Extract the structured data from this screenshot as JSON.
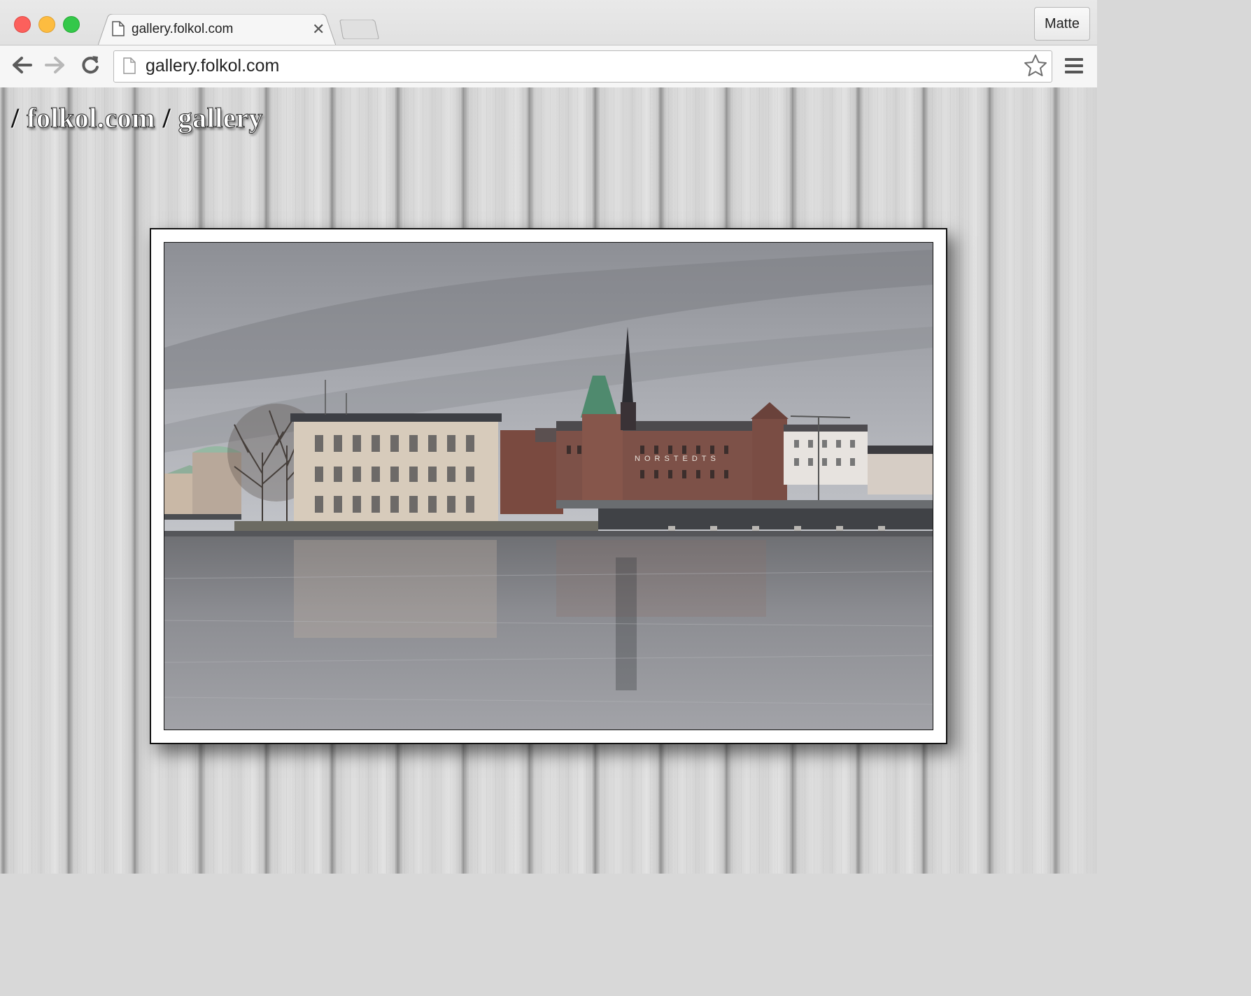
{
  "window": {
    "tab_title": "gallery.folkol.com",
    "profile_label": "Matte",
    "address": "gallery.folkol.com"
  },
  "icons": {
    "tab_page": "page-icon",
    "tab_close": "close-icon",
    "back": "arrow-left-icon",
    "forward": "arrow-right-icon",
    "reload": "reload-icon",
    "address_page": "page-icon",
    "bookmark": "star-icon",
    "menu": "hamburger-menu-icon"
  },
  "page": {
    "breadcrumb": {
      "separator": "/",
      "site": "folkol.com",
      "section": "gallery"
    },
    "photo": {
      "signage_text": "NORSTEDTS"
    }
  },
  "colors": {
    "close": "#fc605c",
    "minimize": "#fdbc40",
    "maximize": "#34c84a",
    "frame": "#ffffff"
  }
}
